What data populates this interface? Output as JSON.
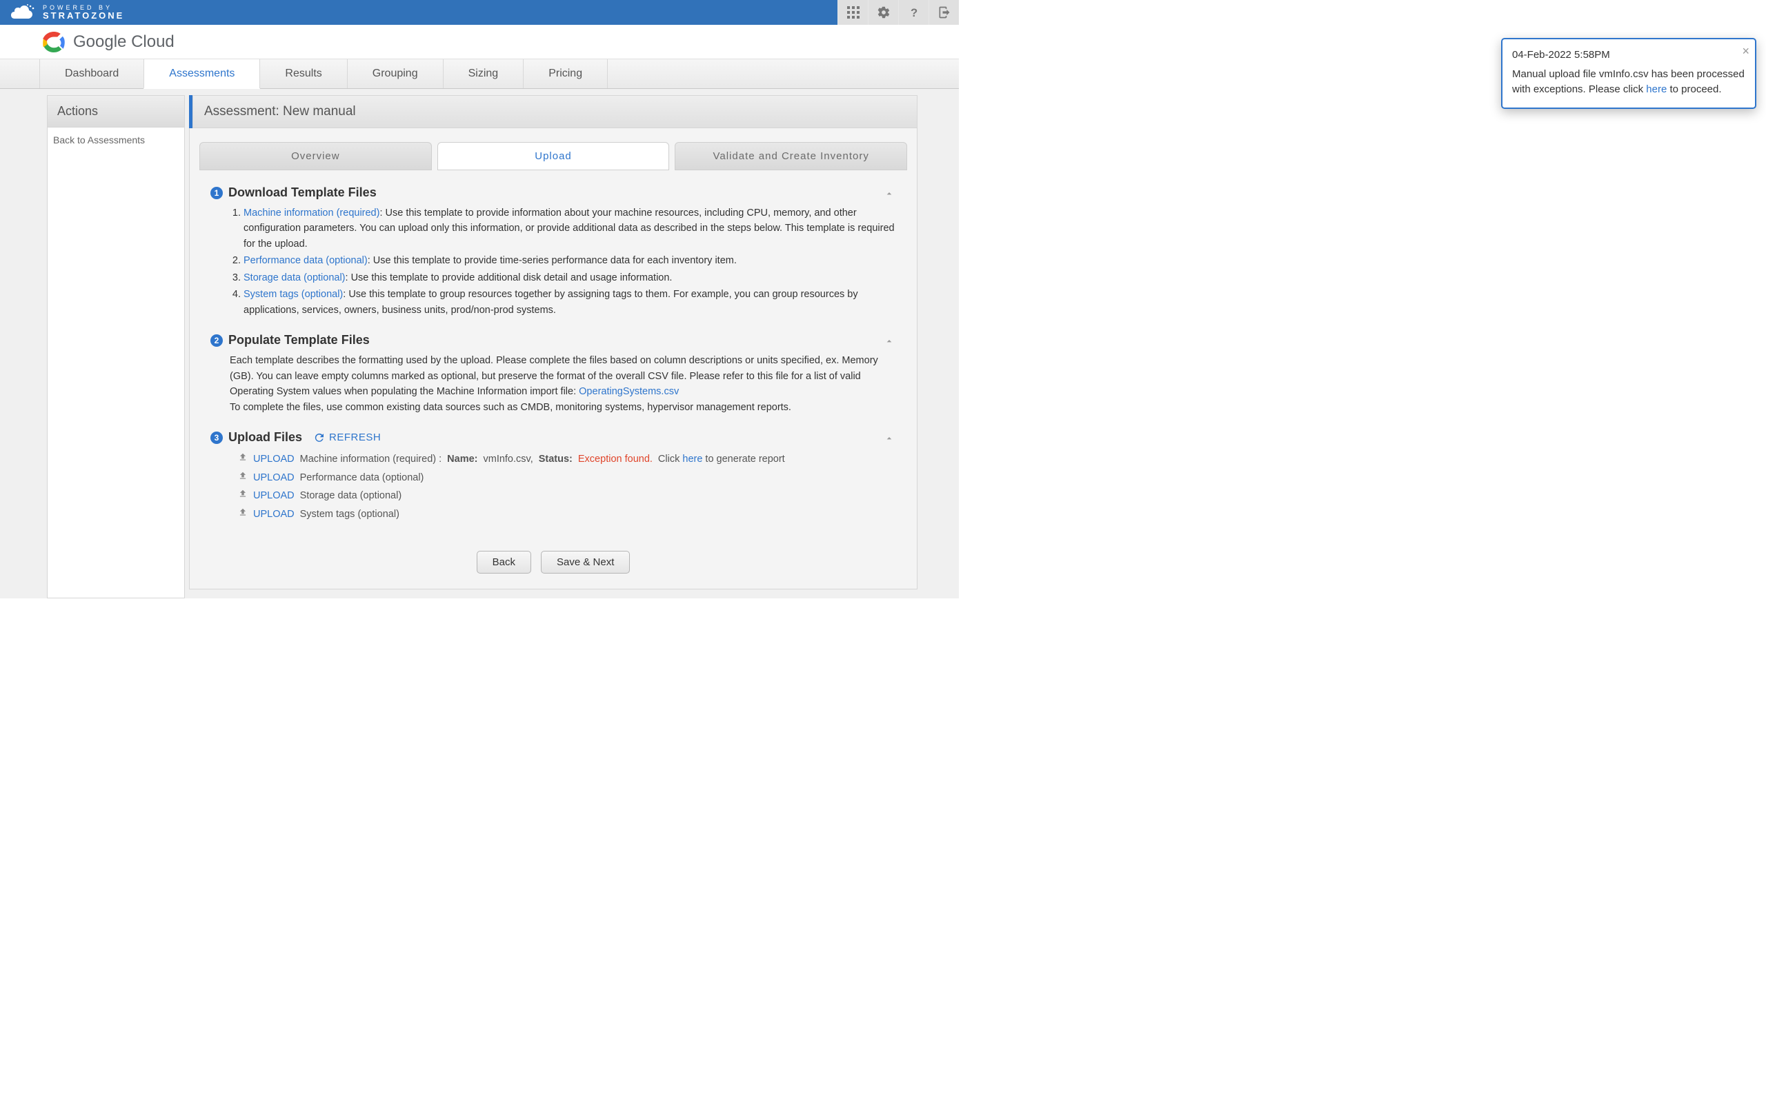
{
  "topbar": {
    "powered_small": "POWERED BY",
    "powered_brand": "STRATOZONE"
  },
  "logo": {
    "text_bold": "Google",
    "text_light": "Cloud"
  },
  "nav": {
    "tabs": [
      {
        "label": "Dashboard"
      },
      {
        "label": "Assessments"
      },
      {
        "label": "Results"
      },
      {
        "label": "Grouping"
      },
      {
        "label": "Sizing"
      },
      {
        "label": "Pricing"
      }
    ],
    "active_index": 1
  },
  "sidebar": {
    "title": "Actions",
    "back_label": "Back to Assessments"
  },
  "panel": {
    "title": "Assessment: New manual"
  },
  "subtabs": {
    "items": [
      {
        "label": "Overview"
      },
      {
        "label": "Upload"
      },
      {
        "label": "Validate and Create Inventory"
      }
    ],
    "active_index": 1
  },
  "step1": {
    "title": "Download Template Files",
    "items": [
      {
        "link": "Machine information (required)",
        "rest": ": Use this template to provide information about your machine resources, including CPU, memory, and other configuration parameters. You can upload only this information, or provide additional data as described in the steps below. This template is required for the upload."
      },
      {
        "link": "Performance data (optional)",
        "rest": ": Use this template to provide time-series performance data for each inventory item."
      },
      {
        "link": "Storage data (optional)",
        "rest": ": Use this template to provide additional disk detail and usage information."
      },
      {
        "link": "System tags (optional)",
        "rest": ": Use this template to group resources together by assigning tags to them. For example, you can group resources by applications, services, owners, business units, prod/non-prod systems."
      }
    ]
  },
  "step2": {
    "title": "Populate Template Files",
    "body_a": "Each template describes the formatting used by the upload. Please complete the files based on column descriptions or units specified, ex. Memory (GB). You can leave empty columns marked as optional, but preserve the format of the overall CSV file. Please refer to this file for a list of valid Operating System values when populating the Machine Information import file: ",
    "os_link": "OperatingSystems.csv",
    "body_b": "To complete the files, use common existing data sources such as CMDB, monitoring systems, hypervisor management reports."
  },
  "step3": {
    "title": "Upload Files",
    "refresh": "REFRESH",
    "upload_label": "UPLOAD",
    "rows": [
      {
        "desc": "Machine information (required) :",
        "name_label": "Name:",
        "name_value": "vmInfo.csv,",
        "status_label": "Status:",
        "status_value": "Exception found.",
        "tail_a": "Click ",
        "tail_link": "here",
        "tail_b": " to generate report"
      },
      {
        "desc": "Performance data (optional)"
      },
      {
        "desc": "Storage data (optional)"
      },
      {
        "desc": "System tags (optional)"
      }
    ]
  },
  "footer": {
    "back": "Back",
    "save_next": "Save & Next"
  },
  "popover": {
    "timestamp": "04-Feb-2022 5:58PM",
    "msg_a": "Manual upload file vmInfo.csv has been processed with exceptions. Please click ",
    "msg_link": "here",
    "msg_b": " to proceed."
  }
}
